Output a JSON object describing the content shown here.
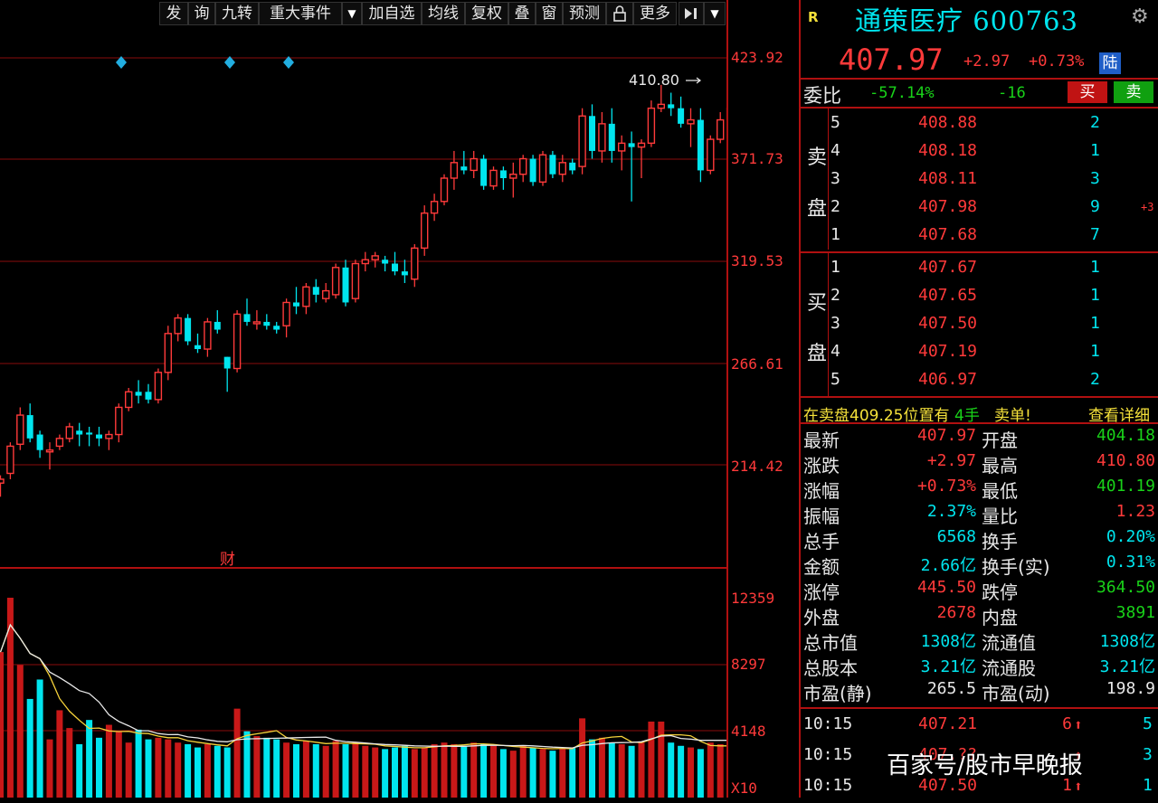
{
  "toolbar": {
    "items": [
      "发",
      "询",
      "九转",
      "重大事件",
      "加自选",
      "均线",
      "复权",
      "叠",
      "窗",
      "预测",
      "更多"
    ]
  },
  "chart": {
    "price_axis": [
      "423.92",
      "371.73",
      "319.53",
      "266.61",
      "214.42"
    ],
    "volume_axis": [
      "12359",
      "8297",
      "4148",
      "X10"
    ],
    "high_marker": "410.80",
    "finance_marker": "财"
  },
  "chart_data": {
    "type": "candlestick",
    "ylim": [
      190,
      435
    ],
    "candles": [
      [
        205,
        209,
        198,
        207
      ],
      [
        210,
        226,
        207,
        224
      ],
      [
        225,
        244,
        222,
        240
      ],
      [
        240,
        246,
        226,
        228
      ],
      [
        230,
        232,
        218,
        222
      ],
      [
        222,
        226,
        212,
        222
      ],
      [
        224,
        230,
        222,
        228
      ],
      [
        228,
        236,
        226,
        234
      ],
      [
        232,
        236,
        224,
        230
      ],
      [
        231,
        234,
        224,
        230
      ],
      [
        230,
        234,
        224,
        228
      ],
      [
        228,
        232,
        222,
        230
      ],
      [
        230,
        246,
        226,
        244
      ],
      [
        244,
        254,
        242,
        252
      ],
      [
        252,
        258,
        246,
        250
      ],
      [
        252,
        256,
        246,
        248
      ],
      [
        248,
        264,
        246,
        262
      ],
      [
        262,
        286,
        258,
        282
      ],
      [
        282,
        292,
        278,
        290
      ],
      [
        290,
        292,
        276,
        278
      ],
      [
        276,
        282,
        272,
        274
      ],
      [
        274,
        290,
        270,
        288
      ],
      [
        288,
        294,
        282,
        284
      ],
      [
        270,
        270,
        252,
        264
      ],
      [
        264,
        294,
        262,
        292
      ],
      [
        292,
        300,
        286,
        288
      ],
      [
        288,
        294,
        284,
        288
      ],
      [
        288,
        292,
        284,
        286
      ],
      [
        286,
        288,
        282,
        284
      ],
      [
        286,
        300,
        280,
        298
      ],
      [
        298,
        306,
        292,
        296
      ],
      [
        296,
        308,
        292,
        306
      ],
      [
        306,
        310,
        298,
        302
      ],
      [
        300,
        308,
        298,
        304
      ],
      [
        302,
        318,
        300,
        316
      ],
      [
        316,
        320,
        296,
        298
      ],
      [
        300,
        320,
        298,
        318
      ],
      [
        318,
        324,
        314,
        320
      ],
      [
        320,
        324,
        316,
        322
      ],
      [
        320,
        322,
        314,
        318
      ],
      [
        318,
        324,
        312,
        314
      ],
      [
        314,
        320,
        308,
        312
      ],
      [
        310,
        328,
        306,
        326
      ],
      [
        326,
        348,
        322,
        344
      ],
      [
        344,
        354,
        340,
        350
      ],
      [
        350,
        364,
        348,
        362
      ],
      [
        362,
        376,
        356,
        370
      ],
      [
        368,
        376,
        364,
        366
      ],
      [
        366,
        376,
        362,
        372
      ],
      [
        372,
        374,
        356,
        358
      ],
      [
        358,
        368,
        356,
        366
      ],
      [
        366,
        368,
        356,
        362
      ],
      [
        362,
        370,
        352,
        364
      ],
      [
        364,
        374,
        360,
        372
      ],
      [
        372,
        374,
        358,
        360
      ],
      [
        360,
        376,
        358,
        374
      ],
      [
        374,
        376,
        362,
        364
      ],
      [
        364,
        374,
        360,
        370
      ],
      [
        370,
        372,
        364,
        366
      ],
      [
        368,
        398,
        364,
        394
      ],
      [
        394,
        400,
        372,
        376
      ],
      [
        376,
        396,
        370,
        390
      ],
      [
        390,
        398,
        370,
        376
      ],
      [
        376,
        384,
        366,
        380
      ],
      [
        380,
        386,
        350,
        378
      ],
      [
        378,
        382,
        362,
        380
      ],
      [
        380,
        402,
        378,
        398
      ],
      [
        398,
        410,
        396,
        400
      ],
      [
        400,
        406,
        394,
        398
      ],
      [
        398,
        404,
        388,
        390
      ],
      [
        390,
        398,
        378,
        392
      ],
      [
        392,
        398,
        360,
        366
      ],
      [
        366,
        384,
        364,
        382
      ],
      [
        382,
        396,
        380,
        392
      ],
      [
        392,
        400,
        386,
        398
      ],
      [
        398,
        414,
        392,
        412
      ],
      [
        412,
        414,
        402,
        408
      ]
    ],
    "volume": [
      9000,
      12359,
      8200,
      6100,
      7300,
      3600,
      5400,
      4300,
      3300,
      4800,
      3700,
      4500,
      4100,
      3400,
      4200,
      3600,
      3700,
      3600,
      3400,
      3300,
      3100,
      3300,
      3200,
      3100,
      5500,
      4100,
      3800,
      3700,
      3600,
      3400,
      3300,
      3500,
      3300,
      3200,
      3500,
      3300,
      3400,
      3200,
      3100,
      3000,
      3100,
      3200,
      3000,
      3100,
      3300,
      3400,
      3300,
      3200,
      3400,
      3300,
      3200,
      3000,
      2900,
      3200,
      3100,
      3000,
      2900,
      3000,
      3100,
      4900,
      3600,
      3700,
      3400,
      3300,
      3200,
      3400,
      4700,
      4700,
      3400,
      3200,
      3100,
      3000,
      3400,
      3300,
      3200,
      3000,
      2700
    ]
  },
  "panel": {
    "rbadge": "R",
    "stock_name": "通策医疗 600763",
    "price": "407.97",
    "change": "+2.97",
    "change_pct": "+0.73%",
    "lu": "陆",
    "weibi_label": "委比",
    "weibi_value": "-57.14%",
    "weicha_value": "-16",
    "buy_button": "买",
    "sell_button": "卖",
    "ask_label_top": "卖",
    "ask_label_bottom": "盘",
    "bid_label_top": "买",
    "bid_label_bottom": "盘",
    "asks": [
      {
        "level": "5",
        "price": "408.88",
        "vol": "2",
        "extra": ""
      },
      {
        "level": "4",
        "price": "408.18",
        "vol": "1",
        "extra": ""
      },
      {
        "level": "3",
        "price": "408.11",
        "vol": "3",
        "extra": ""
      },
      {
        "level": "2",
        "price": "407.98",
        "vol": "9",
        "extra": "+3"
      },
      {
        "level": "1",
        "price": "407.68",
        "vol": "7",
        "extra": ""
      }
    ],
    "bids": [
      {
        "level": "1",
        "price": "407.67",
        "vol": "1"
      },
      {
        "level": "2",
        "price": "407.65",
        "vol": "1"
      },
      {
        "level": "3",
        "price": "407.50",
        "vol": "1"
      },
      {
        "level": "4",
        "price": "407.19",
        "vol": "1"
      },
      {
        "level": "5",
        "price": "406.97",
        "vol": "2"
      }
    ],
    "ticker_a": "在卖盘409.25位置有",
    "ticker_b": "4手",
    "ticker_c": "卖单!",
    "ticker_link": "查看详细",
    "stats": [
      {
        "l1": "最新",
        "v1": "407.97",
        "c1": "red",
        "l2": "开盘",
        "v2": "404.18",
        "c2": "green"
      },
      {
        "l1": "涨跌",
        "v1": "+2.97",
        "c1": "red",
        "l2": "最高",
        "v2": "410.80",
        "c2": "red"
      },
      {
        "l1": "涨幅",
        "v1": "+0.73%",
        "c1": "red",
        "l2": "最低",
        "v2": "401.19",
        "c2": "green"
      },
      {
        "l1": "振幅",
        "v1": "2.37%",
        "c1": "cyan",
        "l2": "量比",
        "v2": "1.23",
        "c2": "red"
      },
      {
        "l1": "总手",
        "v1": "6568",
        "c1": "cyan",
        "l2": "换手",
        "v2": "0.20%",
        "c2": "cyan"
      },
      {
        "l1": "金额",
        "v1": "2.66亿",
        "c1": "cyan",
        "l2": "换手(实)",
        "v2": "0.31%",
        "c2": "cyan"
      },
      {
        "l1": "涨停",
        "v1": "445.50",
        "c1": "red",
        "l2": "跌停",
        "v2": "364.50",
        "c2": "green"
      },
      {
        "l1": "外盘",
        "v1": "2678",
        "c1": "red",
        "l2": "内盘",
        "v2": "3891",
        "c2": "green"
      },
      {
        "l1": "总市值",
        "v1": "1308亿",
        "c1": "cyan",
        "l2": "流通值",
        "v2": "1308亿",
        "c2": "cyan"
      },
      {
        "l1": "总股本",
        "v1": "3.21亿",
        "c1": "cyan",
        "l2": "流通股",
        "v2": "3.21亿",
        "c2": "cyan"
      },
      {
        "l1": "市盈(静)",
        "v1": "265.5",
        "c1": "white",
        "l2": "市盈(动)",
        "v2": "198.9",
        "c2": "white"
      }
    ],
    "trades": [
      {
        "time": "10:15",
        "price": "407.21",
        "vol": "6",
        "count": "5"
      },
      {
        "time": "10:15",
        "price": "407.??",
        "vol": "",
        "count": "3"
      },
      {
        "time": "10:15",
        "price": "407.50",
        "vol": "1",
        "count": "1"
      }
    ]
  },
  "watermark": "百家号/股市早晚报",
  "colors": {
    "up": "#ff3a3a",
    "down": "#00e5ee",
    "frame": "#b01010"
  }
}
